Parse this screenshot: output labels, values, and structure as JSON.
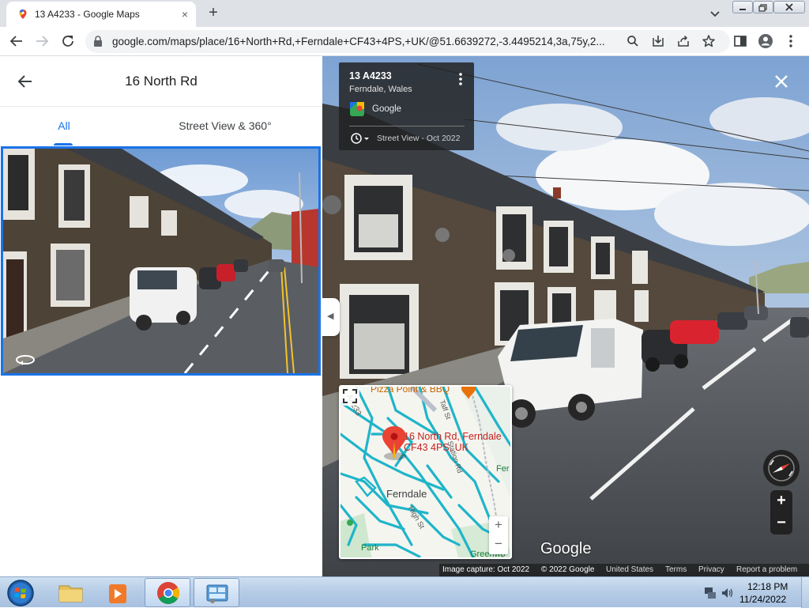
{
  "browser": {
    "tab_title": "13 A4233 - Google Maps",
    "tab_close": "×",
    "new_tab": "+",
    "url": "google.com/maps/place/16+North+Rd,+Ferndale+CF43+4PS,+UK/@51.6639272,-3.4495214,3a,75y,2..."
  },
  "left_panel": {
    "title": "16 North Rd",
    "tabs": [
      {
        "label": "All",
        "selected": true
      },
      {
        "label": "Street View & 360°",
        "selected": false
      }
    ]
  },
  "street_view": {
    "info_card": {
      "title": "13 A4233",
      "subtitle": "Ferndale, Wales",
      "provider": "Google",
      "date": "Street View - Oct 2022"
    },
    "minimap": {
      "poi": "Pizza Point & BBQ",
      "pin_label_line1": "16 North Rd, Ferndale",
      "pin_label_line2": "CF43 4PS, UK",
      "town": "Ferndale",
      "road_a4233": "A4233",
      "road_taff": "Taff St",
      "road_station": "Station Rd",
      "road_high": "High St",
      "fer": "Fer",
      "park": "Park",
      "green": "Greenwo",
      "zoom_in": "+",
      "zoom_out": "−"
    },
    "zoom_in": "+",
    "zoom_out": "−",
    "logo": "Google",
    "footer": {
      "capture": "Image capture: Oct 2022",
      "copyright": "© 2022 Google",
      "region": "United States",
      "terms": "Terms",
      "privacy": "Privacy",
      "report": "Report a problem"
    }
  },
  "taskbar": {
    "time": "12:18 PM",
    "date": "11/24/2022"
  },
  "colors": {
    "accent": "#1a73e8",
    "map_roads": "#1fb5c9",
    "pin": "#ea4335"
  }
}
